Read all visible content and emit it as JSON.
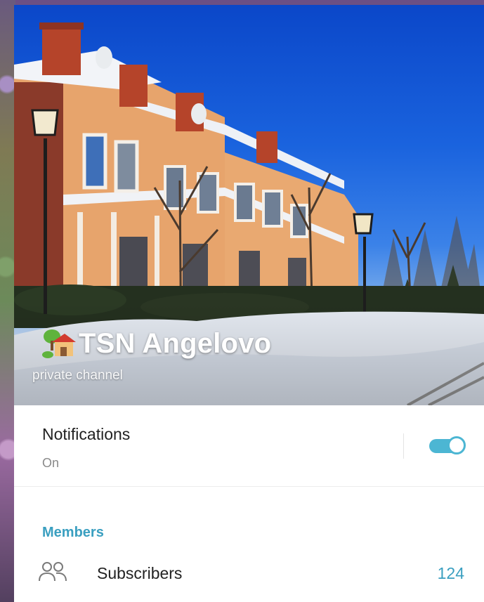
{
  "header": {
    "channel_name": "TSN Angelovo",
    "channel_icon": "house-with-tree-emoji",
    "channel_type": "private channel",
    "background": "photo of snowy townhouses under blue sky"
  },
  "notifications": {
    "label": "Notifications",
    "status": "On",
    "enabled": true,
    "accent_color": "#4cb6d3"
  },
  "members": {
    "section_title": "Members",
    "subscribers_label": "Subscribers",
    "subscribers_icon": "people-icon",
    "subscribers_count": "124",
    "accent_color": "#3a9fc0"
  }
}
